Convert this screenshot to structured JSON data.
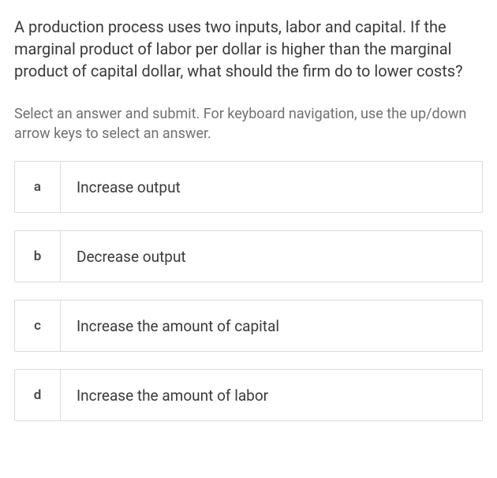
{
  "question": "A production process uses two inputs, labor and capital. If the marginal product of labor per dollar is higher than the marginal product of capital dollar, what should the firm do to lower costs?",
  "instructions": "Select an answer and submit. For keyboard navigation, use the up/down arrow keys to select an answer.",
  "options": [
    {
      "key": "a",
      "label": "Increase output"
    },
    {
      "key": "b",
      "label": "Decrease output"
    },
    {
      "key": "c",
      "label": "Increase the amount of capital"
    },
    {
      "key": "d",
      "label": "Increase the amount of labor"
    }
  ]
}
